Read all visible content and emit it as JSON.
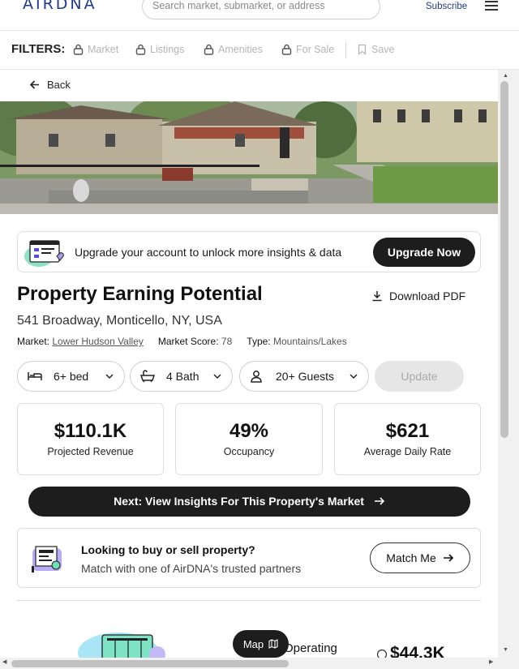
{
  "header": {
    "logo": "AIRDNA",
    "search_placeholder": "Search market, submarket, or address",
    "subscribe": "Subscribe"
  },
  "filters": {
    "label": "FILTERS:",
    "items": [
      "Market",
      "Listings",
      "Amenities",
      "For Sale"
    ],
    "save": "Save"
  },
  "back": "Back",
  "upgrade": {
    "text": "Upgrade your account to unlock more insights & data",
    "button": "Upgrade Now"
  },
  "property": {
    "title": "Property Earning Potential",
    "download": "Download PDF",
    "address": "541 Broadway, Monticello, NY, USA",
    "market_label": "Market:",
    "market_value": "Lower Hudson Valley",
    "score_label": "Market Score:",
    "score_value": "78",
    "type_label": "Type:",
    "type_value": "Mountains/Lakes"
  },
  "selectors": {
    "bed": "6+ bed",
    "bath": "4 Bath",
    "guests": "20+ Guests",
    "update": "Update"
  },
  "metrics": [
    {
      "value": "$110.1K",
      "label": "Projected Revenue"
    },
    {
      "value": "49%",
      "label": "Occupancy"
    },
    {
      "value": "$621",
      "label": "Average Daily Rate"
    }
  ],
  "next_button": "Next:  View Insights For This Property's Market",
  "match": {
    "title": "Looking to buy or sell property?",
    "subtitle": "Match with one of AirDNA's trusted partners",
    "button": "Match Me"
  },
  "bottom": {
    "operating_label": "Operating",
    "operating_value": "$44.3K",
    "map_button": "Map"
  }
}
